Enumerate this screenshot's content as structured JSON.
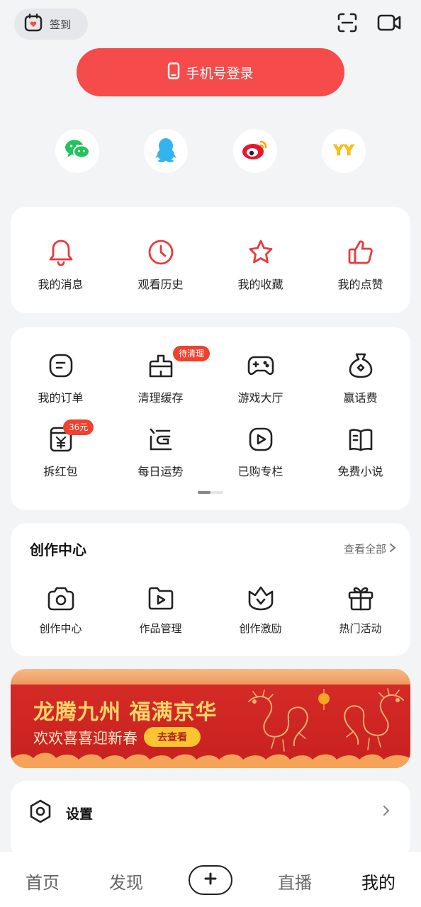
{
  "top": {
    "signin_label": "签到"
  },
  "login": {
    "label": "手机号登录"
  },
  "social": [
    {
      "icon": "wechat-icon",
      "color": "#1fc45a"
    },
    {
      "icon": "qq-icon",
      "color": "#34b4ef"
    },
    {
      "icon": "weibo-icon",
      "color": "#e6162d"
    },
    {
      "icon": "yy-icon",
      "color": "#ffc107"
    }
  ],
  "quick": [
    {
      "label": "我的消息",
      "icon": "bell-icon"
    },
    {
      "label": "观看历史",
      "icon": "clock-icon"
    },
    {
      "label": "我的收藏",
      "icon": "star-icon"
    },
    {
      "label": "我的点赞",
      "icon": "thumb-up-icon"
    }
  ],
  "services": [
    {
      "label": "我的订单",
      "icon": "order-icon"
    },
    {
      "label": "清理缓存",
      "icon": "broom-icon",
      "badge": "待清理"
    },
    {
      "label": "游戏大厅",
      "icon": "gamepad-icon"
    },
    {
      "label": "赢话费",
      "icon": "money-bag-icon"
    },
    {
      "label": "拆红包",
      "icon": "red-packet-icon",
      "badge": "36元"
    },
    {
      "label": "每日运势",
      "icon": "fortune-icon"
    },
    {
      "label": "已购专栏",
      "icon": "play-square-icon"
    },
    {
      "label": "免费小说",
      "icon": "book-icon"
    }
  ],
  "creator": {
    "title": "创作中心",
    "see_all": "查看全部",
    "items": [
      {
        "label": "创作中心",
        "icon": "camera-icon"
      },
      {
        "label": "作品管理",
        "icon": "video-folder-icon"
      },
      {
        "label": "创作激励",
        "icon": "crown-icon"
      },
      {
        "label": "热门活动",
        "icon": "gift-icon"
      }
    ]
  },
  "banner": {
    "title": "龙腾九州 福满京华",
    "subtitle": "欢欢喜喜迎新春",
    "button": "去查看"
  },
  "settings": {
    "label": "设置"
  },
  "tabs": [
    "首页",
    "发现",
    "直播",
    "我的"
  ],
  "colors": {
    "accent": "#f54b4b",
    "icon_red": "#e83a3a"
  }
}
